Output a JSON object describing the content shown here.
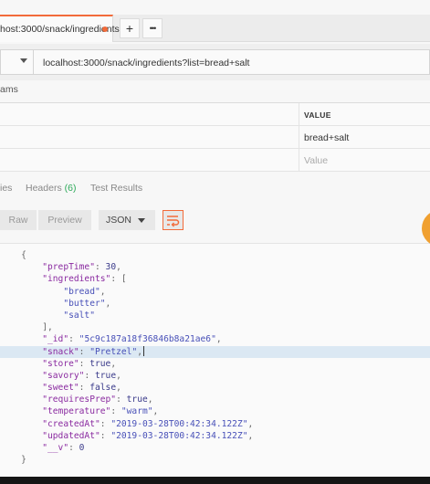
{
  "tab": {
    "title": "host:3000/snack/ingredients",
    "add_label": "+",
    "more_label": "•••"
  },
  "request": {
    "url": "localhost:3000/snack/ingredients?list=bread+salt"
  },
  "params": {
    "label": "ams",
    "value_header": "VALUE",
    "rows": [
      {
        "value": "bread+salt"
      }
    ],
    "value_placeholder": "Value"
  },
  "response_tabs": {
    "cookies_partial": "ies",
    "headers_label": "Headers",
    "headers_count": "(6)",
    "test_results_label": "Test Results"
  },
  "view": {
    "raw_label": "Raw",
    "preview_label": "Preview",
    "format_label": "JSON",
    "wrap_icon": "wrap-lines-icon"
  },
  "response": {
    "prepTime": "30",
    "ingredients": [
      "bread",
      "butter",
      "salt"
    ],
    "_id": "5c9c187a18f36846b8a21ae6",
    "snack": "Pretzel",
    "store": "true",
    "savory": "true",
    "sweet": "false",
    "requiresPrep": "true",
    "temperature": "warm",
    "createdAt": "2019-03-28T00:42:34.122Z",
    "updatedAt": "2019-03-28T00:42:34.122Z",
    "__v": "0"
  },
  "colors": {
    "accent": "#f26b3a",
    "json_key": "#8a2aa0",
    "json_string": "#4850b8",
    "highlight": "#dbe8f3",
    "count_green": "#2eaa5a"
  }
}
